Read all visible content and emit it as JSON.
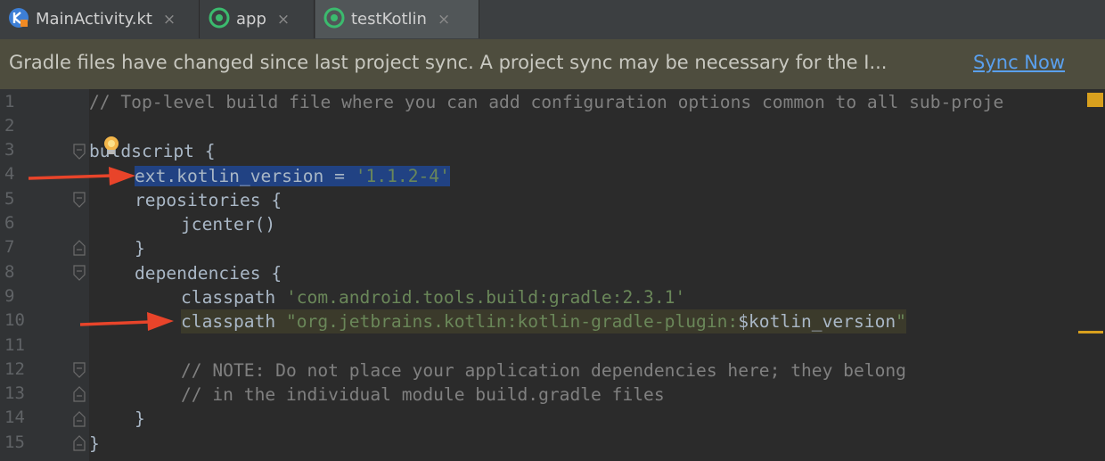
{
  "tabs": [
    {
      "label": "MainActivity.kt",
      "icon": "kotlin-file-icon",
      "close": "×"
    },
    {
      "label": "app",
      "icon": "gradle-icon",
      "close": "×"
    },
    {
      "label": "testKotlin",
      "icon": "gradle-icon",
      "close": "×"
    }
  ],
  "banner": {
    "message": "Gradle files have changed since last project sync. A project sync may be necessary for the I...",
    "action": "Sync Now"
  },
  "gutter": {
    "line_numbers": [
      "1",
      "2",
      "3",
      "4",
      "5",
      "6",
      "7",
      "8",
      "9",
      "10",
      "11",
      "12",
      "13",
      "14",
      "15"
    ]
  },
  "code": {
    "l1": "// Top-level build file where you can add configuration options common to all sub-proje",
    "l3a": "bu",
    "l3b": "ldscript {",
    "l4a": "ext.kotlin_version = ",
    "l4b": "'1.1.2-4'",
    "l5": "repositories {",
    "l6": "jcenter()",
    "l7": "}",
    "l8": "dependencies {",
    "l9a": "classpath ",
    "l9b": "'com.android.tools.build:gradle:2.3.1'",
    "l10a": "classpath ",
    "l10b": "\"org.jetbrains.kotlin:kotlin-gradle-plugin:",
    "l10c": "$kotlin_version",
    "l10d": "\"",
    "l12": "// NOTE: Do not place your application dependencies here; they belong",
    "l13": "// in the individual module build.gradle files",
    "l14": "}",
    "l15": "}"
  },
  "colors": {
    "arrow": "#e8442a",
    "selection": "#214283",
    "string": "#6a8759",
    "comment": "#808080",
    "link": "#5aa0ee"
  }
}
